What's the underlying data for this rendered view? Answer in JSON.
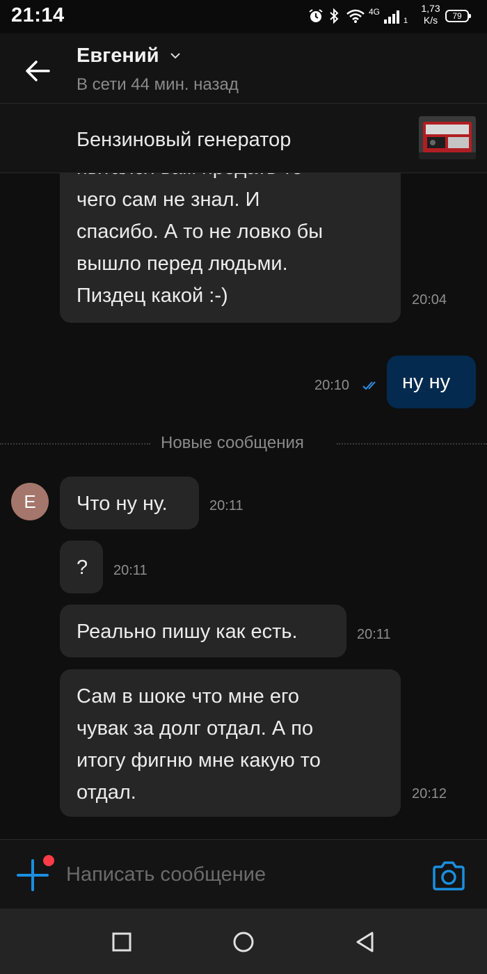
{
  "status_bar": {
    "time": "21:14",
    "network_type": "4G",
    "sim_index": "1",
    "speed_value": "1,73",
    "speed_unit": "K/s",
    "battery": "79",
    "icons": [
      "alarm-icon",
      "bluetooth-icon",
      "wifi-icon",
      "signal-icon",
      "battery-icon"
    ]
  },
  "header": {
    "contact_name": "Евгений",
    "status": "В сети 44 мин. назад"
  },
  "listing": {
    "title": "Бензиновый генератор"
  },
  "messages": [
    {
      "direction": "incoming",
      "lines": [
        "пытался вам продать то",
        "чего сам не знал. И",
        "спасибо. А то не ловко бы",
        "вышло перед людьми.",
        "Пиздец какой :-)"
      ],
      "time": "20:04"
    },
    {
      "direction": "outgoing",
      "text": "ну ну",
      "time": "20:10",
      "read": true
    },
    {
      "direction": "incoming",
      "text": "Что ну ну.",
      "time": "20:11",
      "avatar_letter": "Е"
    },
    {
      "direction": "incoming",
      "text": "?",
      "time": "20:11"
    },
    {
      "direction": "incoming",
      "text": "Реально пишу как есть.",
      "time": "20:11"
    },
    {
      "direction": "incoming",
      "lines": [
        "Сам в шоке что мне его",
        "чувак за долг отдал. А по",
        "итогу фигню мне какую то",
        "отдал."
      ],
      "time": "20:12"
    }
  ],
  "divider": {
    "label": "Новые сообщения"
  },
  "input": {
    "placeholder": "Написать сообщение"
  },
  "colors": {
    "background": "#0f0f0f",
    "incoming_bubble": "#262626",
    "outgoing_bubble": "#052a4f",
    "accent": "#1a8fe0",
    "notification_dot": "#ff3b47",
    "avatar": "#a5766b"
  }
}
